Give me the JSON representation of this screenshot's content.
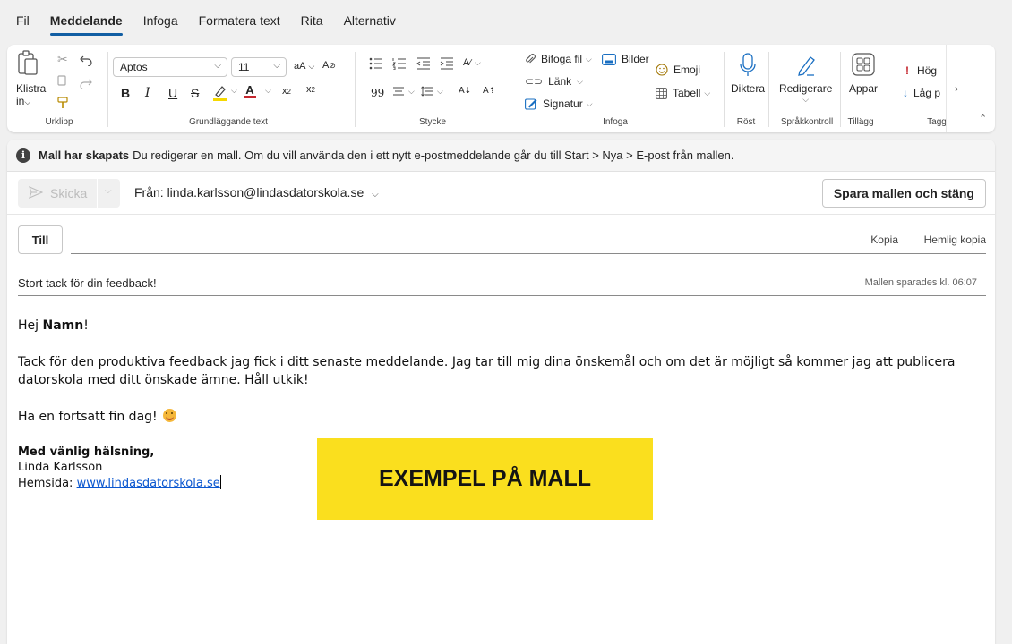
{
  "menu": {
    "tabs": [
      {
        "label": "Fil"
      },
      {
        "label": "Meddelande"
      },
      {
        "label": "Infoga"
      },
      {
        "label": "Formatera text"
      },
      {
        "label": "Rita"
      },
      {
        "label": "Alternativ"
      }
    ]
  },
  "ribbon": {
    "clipboard": {
      "paste_label": "Klistra",
      "paste_label2": "in",
      "group": "Urklipp"
    },
    "text": {
      "font": "Aptos",
      "size": "11",
      "grow_label": "aA",
      "group": "Grundläggande text"
    },
    "paragraph": {
      "group": "Stycke"
    },
    "insert": {
      "attach": "Bifoga fil",
      "images": "Bilder",
      "link": "Länk",
      "signature": "Signatur",
      "emoji": "Emoji",
      "table": "Tabell",
      "group": "Infoga"
    },
    "voice": {
      "dictate": "Diktera",
      "group": "Röst"
    },
    "editor": {
      "edit": "Redigerare",
      "group": "Språkkontroll"
    },
    "addins": {
      "apps": "Appar",
      "group": "Tillägg"
    },
    "tags": {
      "high": "Hög",
      "low": "Låg p",
      "group": "Tagg"
    }
  },
  "infobar": {
    "title": "Mall har skapats",
    "text": "Du redigerar en mall. Om du vill använda den i ett nytt e-postmeddelande går du till Start > Nya > E-post från mallen."
  },
  "compose": {
    "send_label": "Skicka",
    "from_label": "Från: linda.karlsson@lindasdatorskola.se",
    "save_label": "Spara mallen och stäng",
    "to_label": "Till",
    "cc_label": "Kopia",
    "bcc_label": "Hemlig kopia",
    "subject": "Stort tack för din feedback!",
    "saved_status": "Mallen sparades kl. 06:07"
  },
  "message": {
    "greeting_prefix": "Hej ",
    "greeting_name": "Namn",
    "greeting_suffix": "!",
    "paragraph": "Tack för den produktiva feedback jag fick i ditt senaste meddelande. Jag tar till mig dina önskemål och om det är möjligt så kommer jag att publicera datorskola med ditt önskade ämne. Håll utkik!",
    "closing": "Ha en fortsatt fin dag!",
    "sig_greeting": "Med vänlig hälsning,",
    "sig_name": "Linda Karlsson",
    "sig_site_label": "Hemsida: ",
    "sig_site_link": "www.lindasdatorskola.se"
  },
  "stamp": {
    "text": "EXEMPEL PÅ MALL",
    "color": "#fadf1e"
  },
  "colors": {
    "accent": "#115ea3",
    "link": "#0b57d0",
    "highlight": "#f5d800",
    "font_color": "#c4262e"
  }
}
